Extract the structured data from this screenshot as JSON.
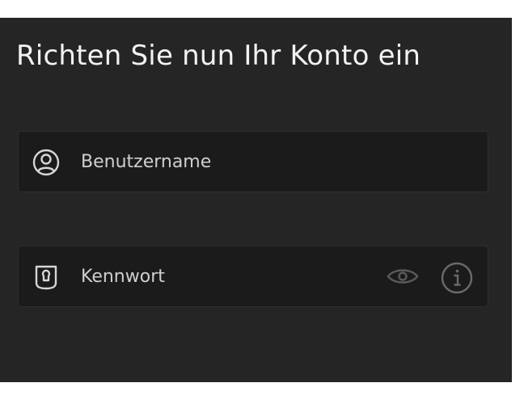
{
  "heading": "Richten Sie nun Ihr Konto ein",
  "username_field": {
    "placeholder": "Benutzername",
    "value": "",
    "icon": "user-circle-icon"
  },
  "password_field": {
    "placeholder": "Kennwort",
    "value": "",
    "icon": "keyhole-icon",
    "reveal_icon": "eye-icon",
    "info_icon": "info-icon"
  },
  "colors": {
    "panel_background": "#252525",
    "field_background": "#1b1b1b",
    "heading_text": "#f2f2f2",
    "field_text": "#cfcfcf",
    "muted_icon": "#5a5a5a"
  }
}
